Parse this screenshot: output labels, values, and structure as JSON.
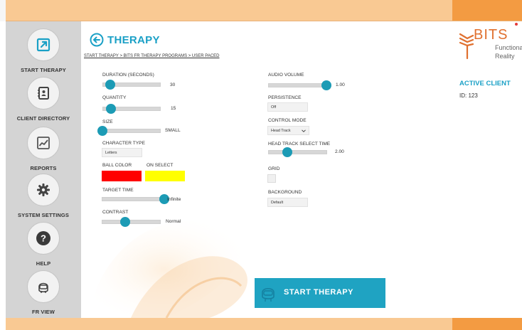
{
  "header": {
    "title": "THERAPY",
    "breadcrumb": "START THERAPY > BITS FR THERAPY PROGRAMS > USER PACED"
  },
  "sidebar": {
    "items": [
      {
        "label": "START THERAPY",
        "icon": "launch-icon"
      },
      {
        "label": "CLIENT DIRECTORY",
        "icon": "address-book-icon"
      },
      {
        "label": "REPORTS",
        "icon": "chart-icon"
      },
      {
        "label": "SYSTEM SETTINGS",
        "icon": "gear-icon"
      },
      {
        "label": "HELP",
        "icon": "help-icon"
      },
      {
        "label": "FR VIEW",
        "icon": "vr-headset-icon"
      }
    ]
  },
  "settings": {
    "duration": {
      "label": "DURATION (SECONDS)",
      "value": "30",
      "fraction": 0.13
    },
    "quantity": {
      "label": "QUANTITY",
      "value": "15",
      "fraction": 0.15
    },
    "size": {
      "label": "SIZE",
      "value": "SMALL",
      "fraction": 0.0
    },
    "character_type": {
      "label": "CHARACTER TYPE",
      "value": "Letters"
    },
    "ball_color": {
      "label": "BALL COLOR",
      "color": "#ff0000"
    },
    "on_select": {
      "label": "ON SELECT",
      "color": "#ffff00"
    },
    "target_time": {
      "label": "TARGET TIME",
      "value": "Infinite",
      "fraction": 1.0
    },
    "contrast": {
      "label": "CONTRAST",
      "value": "Normal",
      "fraction": 0.4
    },
    "audio_volume": {
      "label": "AUDIO VOLUME",
      "value": "1.00",
      "fraction": 1.0
    },
    "persistence": {
      "label": "PERSISTENCE",
      "value": "Off"
    },
    "control_mode": {
      "label": "CONTROL MODE",
      "value": "Head Track"
    },
    "head_track_select_time": {
      "label": "HEAD TRACK SELECT TIME",
      "value": "2.00",
      "fraction": 0.33
    },
    "grid": {
      "label": "GRID",
      "checked": false
    },
    "background": {
      "label": "BACKGROUND",
      "value": "Default"
    }
  },
  "logo": {
    "brand": "BITS",
    "line1": "Functional",
    "line2": "Reality"
  },
  "client": {
    "title": "ACTIVE CLIENT",
    "id": "ID: 123"
  },
  "start_button": {
    "label": "START THERAPY"
  },
  "colors": {
    "accent": "#1aa0c6",
    "slider_thumb": "#1c9bb5",
    "button": "#1fa3c2",
    "bar_light": "#f9c993",
    "bar_dark": "#f39b42",
    "brand": "#e0702f"
  }
}
